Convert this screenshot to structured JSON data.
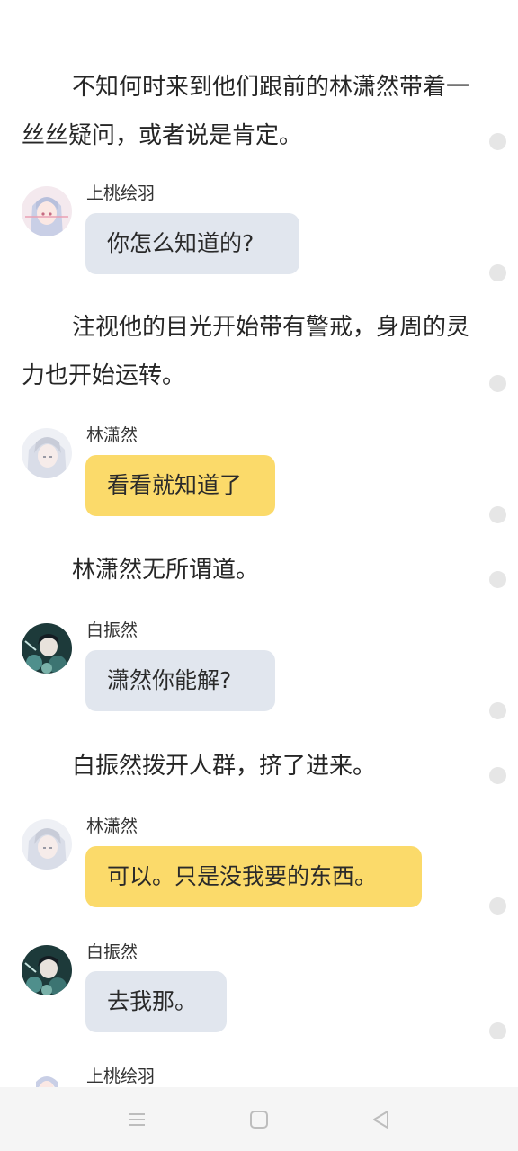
{
  "story": {
    "narration_1": "不知何时来到他们跟前的林潇然带着一丝丝疑问，或者说是肯定。",
    "speaker_1": "上桃绘羽",
    "bubble_1": "你怎么知道的?",
    "narration_2": "注视他的目光开始带有警戒，身周的灵力也开始运转。",
    "speaker_2": "林潇然",
    "bubble_2": "看看就知道了",
    "narration_3": "林潇然无所谓道。",
    "speaker_3": "白振然",
    "bubble_3": "潇然你能解?",
    "narration_4": "白振然拨开人群，挤了进来。",
    "speaker_4": "林潇然",
    "bubble_4": "可以。只是没我要的东西。",
    "speaker_5": "白振然",
    "bubble_5": "去我那。",
    "speaker_6": "上桃绘羽"
  },
  "colors": {
    "bubble_gray": "#e1e6ee",
    "bubble_yellow": "#fbda6a",
    "navbar": "#f5f5f5"
  },
  "navbar": {
    "icons": [
      "menu-icon",
      "home-square-icon",
      "back-triangle-icon"
    ]
  }
}
